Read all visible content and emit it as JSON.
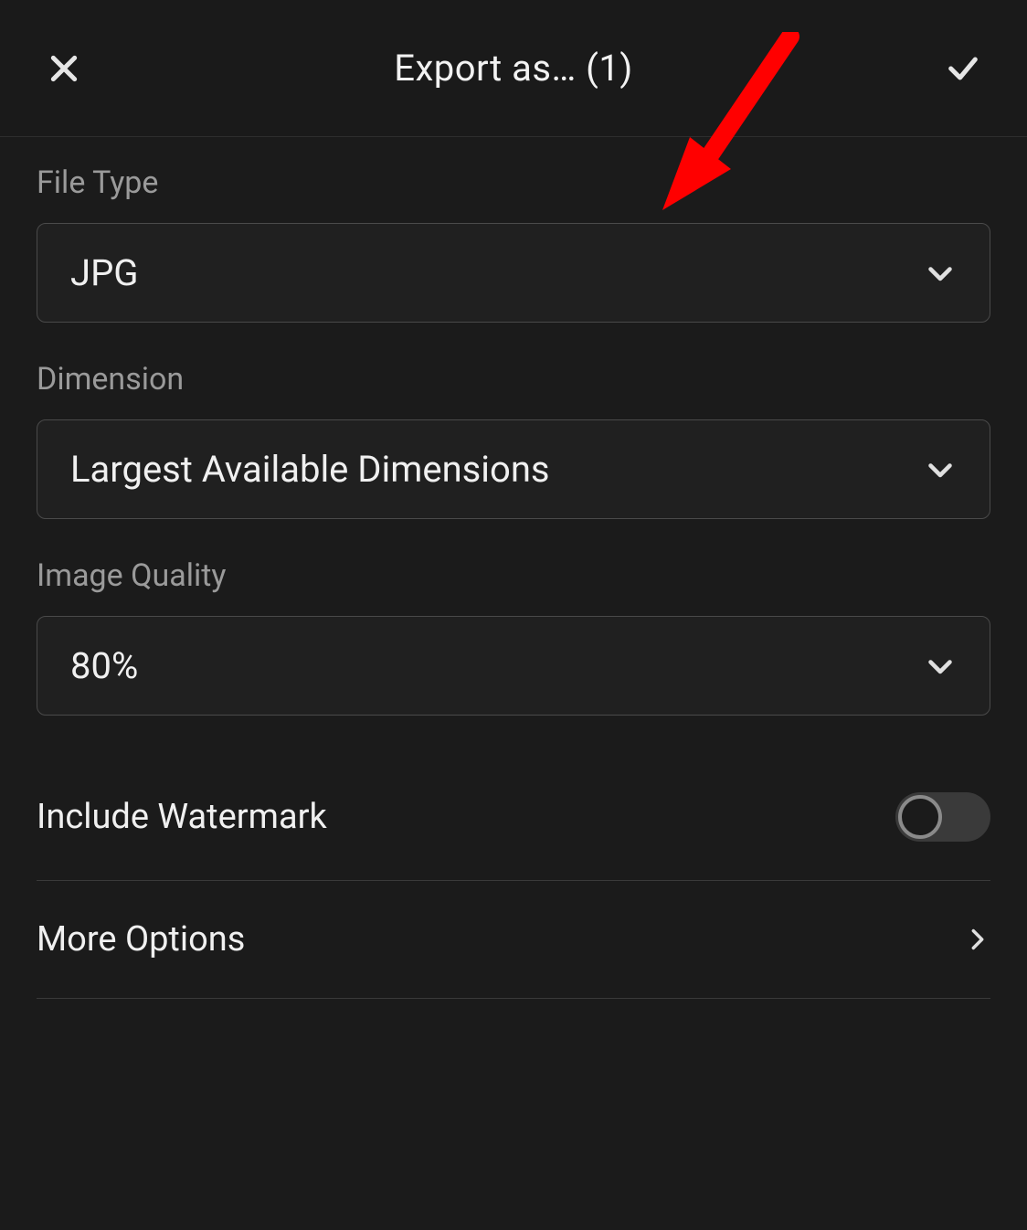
{
  "header": {
    "title": "Export as… (1)"
  },
  "fields": {
    "file_type": {
      "label": "File Type",
      "value": "JPG"
    },
    "dimension": {
      "label": "Dimension",
      "value": "Largest Available Dimensions"
    },
    "image_quality": {
      "label": "Image Quality",
      "value": "80%"
    }
  },
  "rows": {
    "watermark": {
      "label": "Include Watermark",
      "enabled": false
    },
    "more_options": {
      "label": "More Options"
    }
  },
  "annotation": {
    "arrow_color": "#ff0000"
  }
}
